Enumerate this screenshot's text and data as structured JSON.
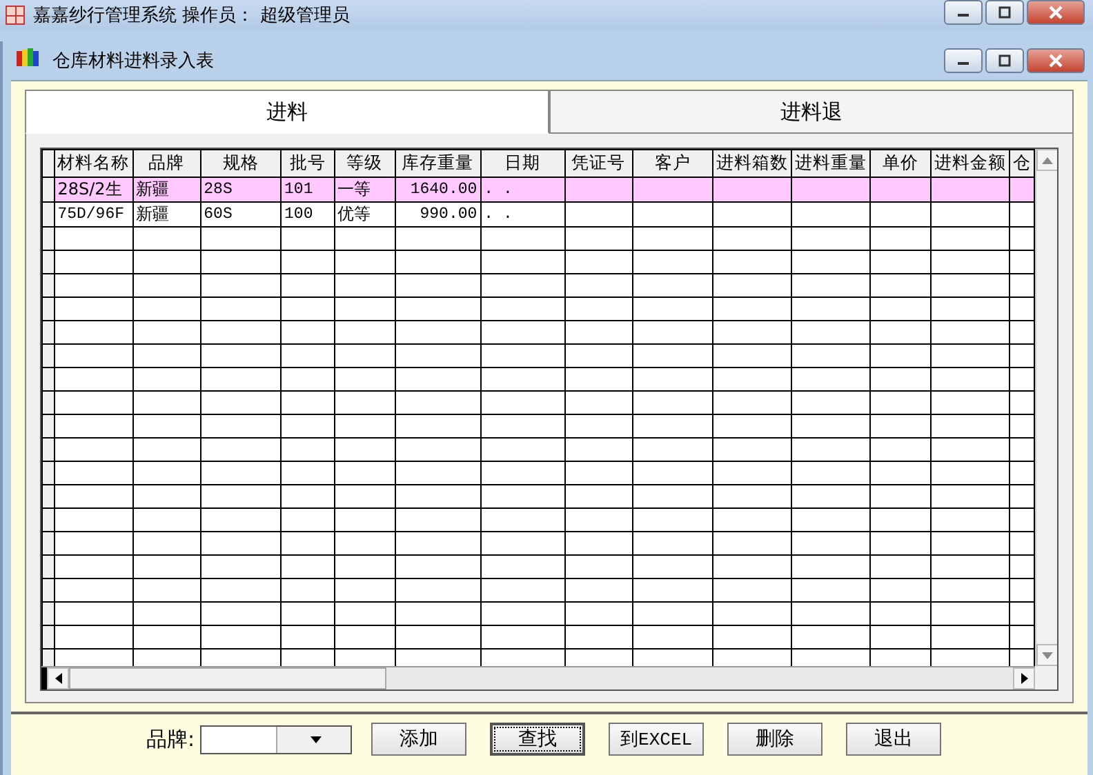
{
  "app_window": {
    "title": "嘉嘉纱行管理系统 操作员： 超级管理员"
  },
  "form_window": {
    "title": "仓库材料进料录入表"
  },
  "tabs": [
    {
      "label": "进料",
      "selected": true
    },
    {
      "label": "进料退",
      "selected": false
    }
  ],
  "table": {
    "columns": [
      "材料名称",
      "品牌",
      "规格",
      "批号",
      "等级",
      "库存重量",
      "日期",
      "凭证号",
      "客户",
      "进料箱数",
      "进料重量",
      "单价",
      "进料金额",
      "仓"
    ],
    "rows": [
      {
        "selected": true,
        "cells": [
          "28S/2生",
          "新疆",
          "28S",
          "101",
          "一等",
          "1640.00",
          ". .",
          "",
          "",
          "",
          "",
          "",
          "",
          ""
        ]
      },
      {
        "selected": false,
        "cells": [
          "75D/96F",
          "新疆",
          "60S",
          "100",
          "优等",
          "990.00",
          ". .",
          "",
          "",
          "",
          "",
          "",
          "",
          ""
        ]
      }
    ]
  },
  "bottom_bar": {
    "brand_label": "品牌:",
    "buttons": [
      {
        "label": "添加",
        "focused": false
      },
      {
        "label": "查找",
        "focused": true
      },
      {
        "label": "到EXCEL",
        "focused": false
      },
      {
        "label": "删除",
        "focused": false
      },
      {
        "label": "退出",
        "focused": false
      }
    ]
  }
}
